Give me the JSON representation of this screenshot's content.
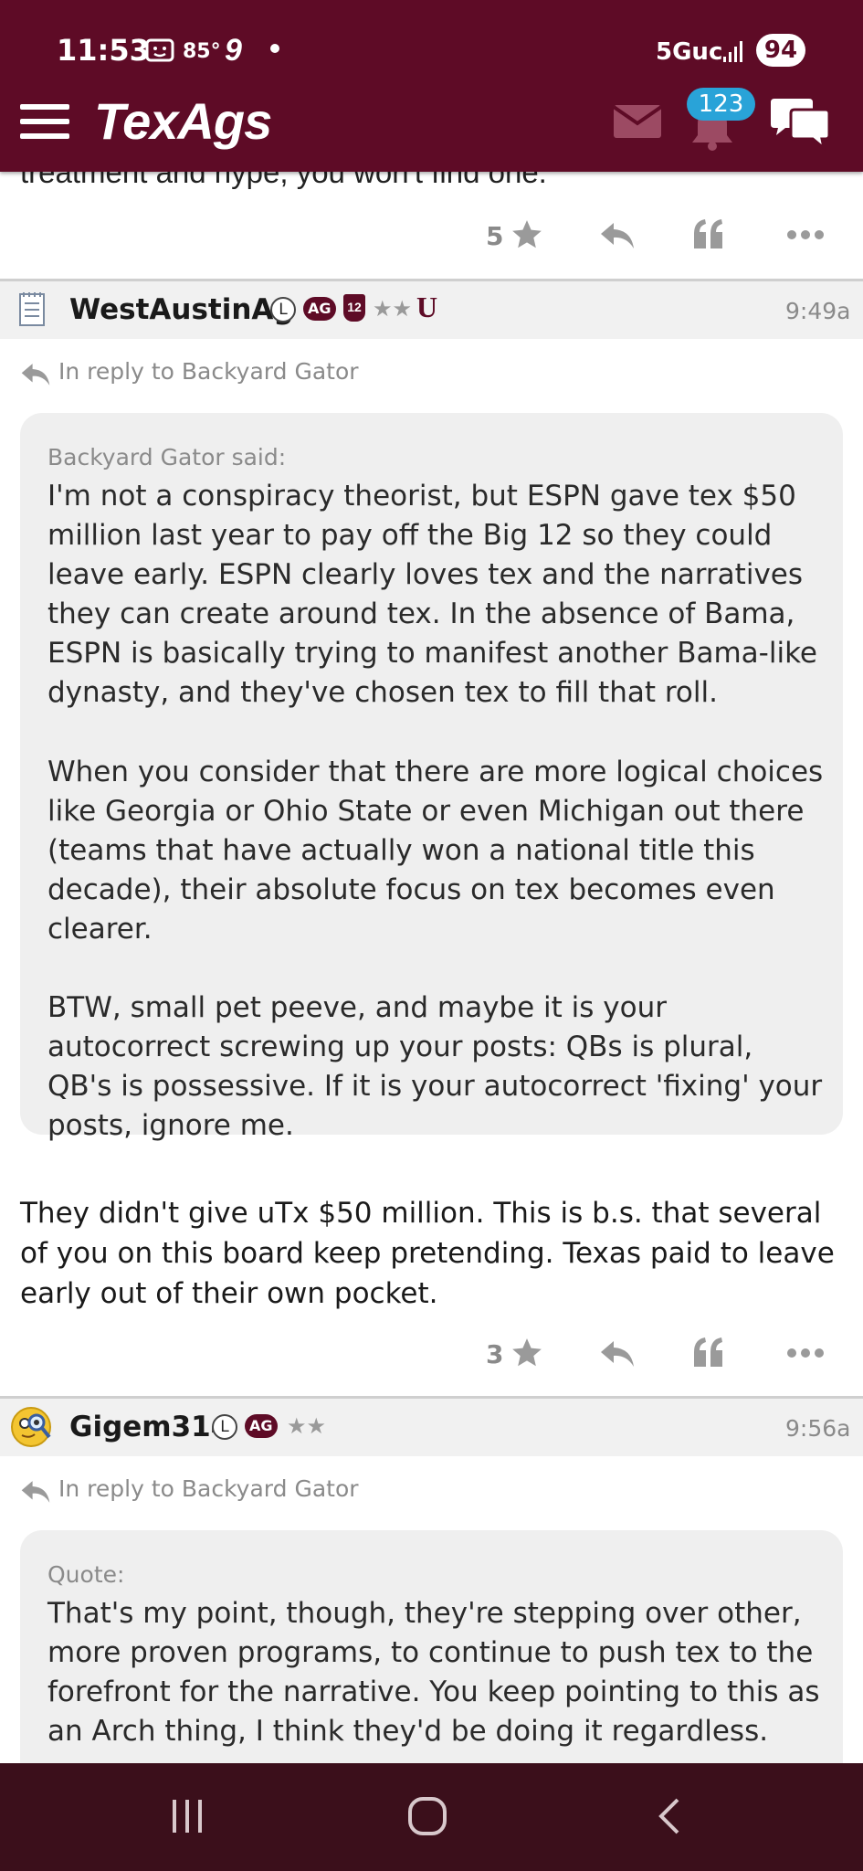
{
  "status_bar": {
    "time": "11:53",
    "temperature": "85°",
    "network": "5Guc",
    "battery": "94"
  },
  "header": {
    "logo": "TexAgs",
    "notifications_count": "123"
  },
  "previous_post": {
    "partial_text": "treatment and hype, you won't find one.",
    "star_count": "5"
  },
  "posts": [
    {
      "username": "WestAustinAg",
      "badges": {
        "l": "L",
        "ag": "AG",
        "twelve": "12",
        "stars": "★★",
        "u": "U"
      },
      "time": "9:49a",
      "reply_to": "In reply to Backyard Gator",
      "quote_label": "Backyard Gator said:",
      "quote_paragraphs": [
        "I'm not a conspiracy theorist, but ESPN gave tex $50 million last year to pay off the Big 12 so they could leave early. ESPN clearly loves tex and the narratives they can create around tex. In the absence of Bama, ESPN is basically trying to manifest another Bama-like dynasty, and they've chosen tex to fill that roll.",
        "When you consider that there are more logical choices like Georgia or Ohio State or even Michigan out there (teams that have actually won a national title this decade), their absolute focus on tex becomes even clearer.",
        "BTW, small pet peeve, and maybe it is your autocorrect screwing up your posts: QBs is plural, QB's is possessive. If it is your autocorrect 'fixing' your posts, ignore me."
      ],
      "body": "They didn't give uTx $50 million. This is b.s. that several of you on this board keep pretending. Texas paid to leave early out of their own pocket.",
      "star_count": "3"
    },
    {
      "username": "Gigem314",
      "badges": {
        "l": "L",
        "ag": "AG",
        "stars": "★★"
      },
      "time": "9:56a",
      "reply_to": "In reply to Backyard Gator",
      "quote_label": "Quote:",
      "quote_paragraphs": [
        "That's my point, though, they're stepping over other, more proven programs, to continue to push tex to the forefront for the narrative. You keep pointing to this as an Arch thing, I think they'd be doing it regardless."
      ]
    }
  ],
  "icons": {
    "menu": "hamburger-menu-icon",
    "mail": "mail-icon",
    "bell": "bell-icon",
    "chat": "chat-icon",
    "star": "star-icon",
    "reply": "reply-icon",
    "quote": "quote-icon",
    "more": "more-icon"
  },
  "colors": {
    "brand_maroon": "#5e0b26",
    "badge_blue": "#29a3d8",
    "nav_bar": "#3b0f1b"
  }
}
